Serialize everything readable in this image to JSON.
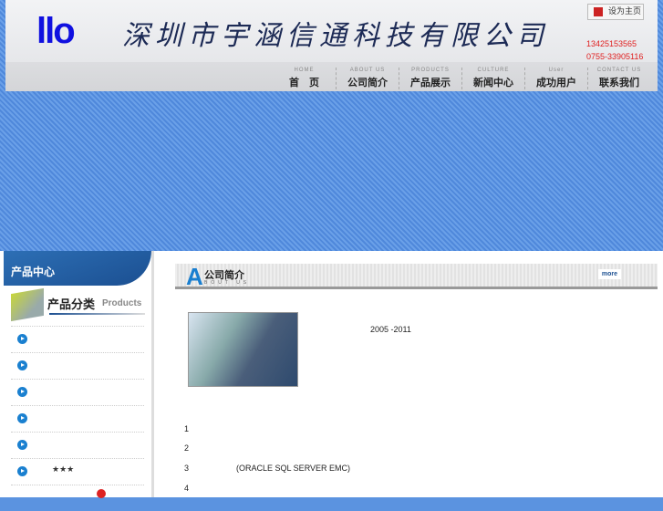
{
  "header": {
    "logo": "llo",
    "company_name": "深圳市宇涵信通科技有限公司",
    "set_home": "设为主页",
    "phones": [
      "13425153565",
      "0755-33905116"
    ]
  },
  "nav": [
    {
      "en": "HOME",
      "cn": "首　页"
    },
    {
      "en": "ABOUT US",
      "cn": "公司简介"
    },
    {
      "en": "PRODUCTS",
      "cn": "产品展示"
    },
    {
      "en": "CULTURE",
      "cn": "新闻中心"
    },
    {
      "en": "User",
      "cn": "成功用户"
    },
    {
      "en": "CONTACT US",
      "cn": "联系我们"
    }
  ],
  "sidebar": {
    "title": "产品中心",
    "cat_cn": "产品分类",
    "cat_en": "Products",
    "items": [
      "",
      "",
      "",
      "",
      "",
      "★★★"
    ]
  },
  "about": {
    "letter": "A",
    "title": "公司简介",
    "subtitle": "BOUT US",
    "more": "more",
    "years": "2005 -2011",
    "numbers": [
      "1",
      "2",
      "3",
      "4"
    ],
    "line3": "(ORACLE SQL SERVER EMC)"
  }
}
